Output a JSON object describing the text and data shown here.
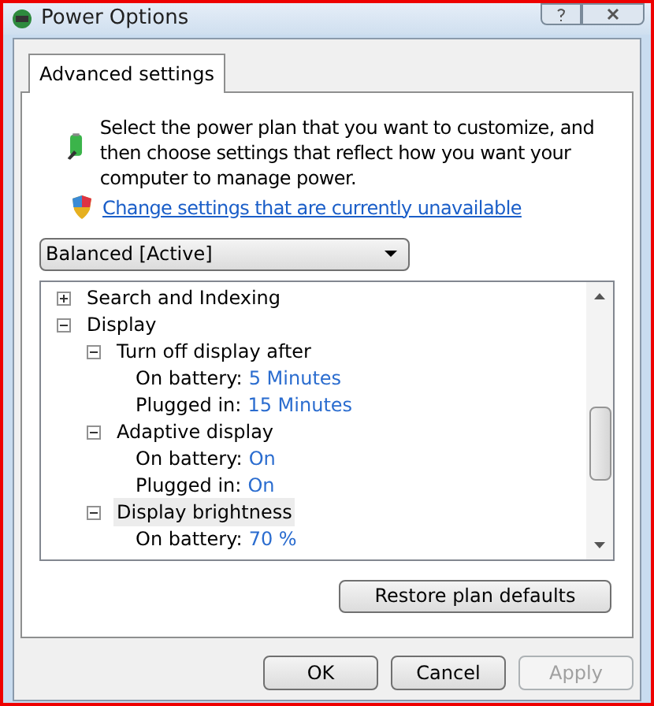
{
  "window": {
    "title": "Power Options"
  },
  "tabs": [
    {
      "label": "Advanced settings",
      "selected": true
    }
  ],
  "intro": "Select the power plan that you want to customize, and then choose settings that reflect how you want your computer to manage power.",
  "change_link": "Change settings that are currently unavailable",
  "plan_select": {
    "value": "Balanced [Active]"
  },
  "tree": [
    {
      "kind": "group",
      "label": "Search and Indexing",
      "expanded": false,
      "selected": false
    },
    {
      "kind": "group",
      "label": "Display",
      "expanded": true,
      "selected": false,
      "children": [
        {
          "kind": "group",
          "label": "Turn off display after",
          "expanded": true,
          "selected": false,
          "children": [
            {
              "kind": "setting",
              "label": "On battery:",
              "value": "5 Minutes"
            },
            {
              "kind": "setting",
              "label": "Plugged in:",
              "value": "15 Minutes"
            }
          ]
        },
        {
          "kind": "group",
          "label": "Adaptive display",
          "expanded": true,
          "selected": false,
          "children": [
            {
              "kind": "setting",
              "label": "On battery:",
              "value": "On"
            },
            {
              "kind": "setting",
              "label": "Plugged in:",
              "value": "On"
            }
          ]
        },
        {
          "kind": "group",
          "label": "Display brightness",
          "expanded": true,
          "selected": true,
          "children": [
            {
              "kind": "setting",
              "label": "On battery:",
              "value": "70 %"
            }
          ]
        }
      ]
    }
  ],
  "restore_button": "Restore plan defaults",
  "buttons": [
    {
      "label": "OK",
      "disabled": false
    },
    {
      "label": "Cancel",
      "disabled": false
    },
    {
      "label": "Apply",
      "disabled": true
    }
  ]
}
